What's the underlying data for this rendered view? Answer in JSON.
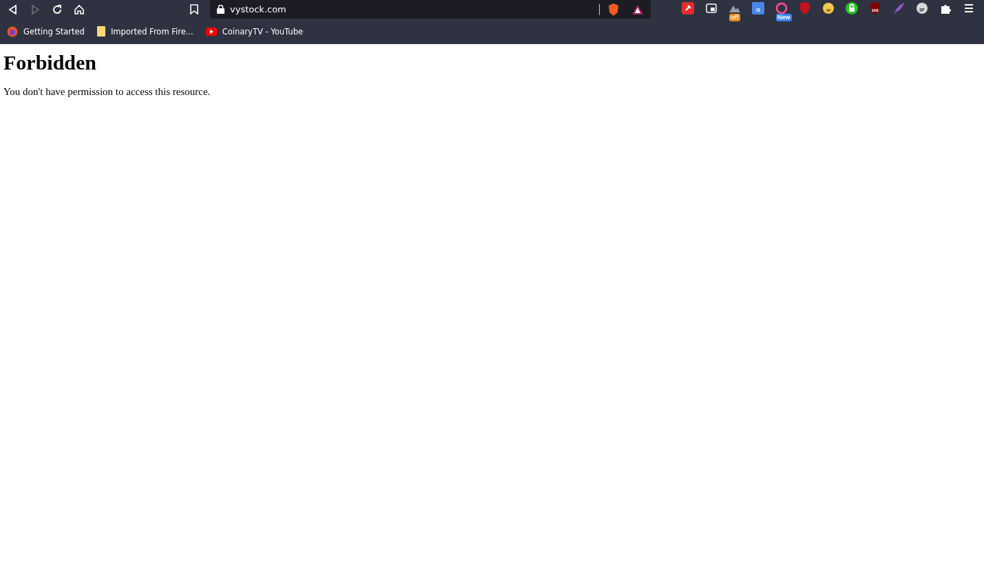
{
  "toolbar": {
    "url": "vystock.com",
    "back_disabled": false,
    "forward_disabled": true
  },
  "extensions": [
    {
      "kind": "pin",
      "color": "#e32b2b"
    },
    {
      "kind": "pip",
      "color": "#ffffff"
    },
    {
      "kind": "mountain",
      "color": "#9a9aa8",
      "badge": "off"
    },
    {
      "kind": "translate",
      "color": "#4a86e8",
      "glyph": "G"
    },
    {
      "kind": "ring",
      "color": "#e84a8a",
      "badge": "New"
    },
    {
      "kind": "shield",
      "color": "#c0141c"
    },
    {
      "kind": "circle",
      "color": "#f2c94c",
      "glyph": "w"
    },
    {
      "kind": "lock",
      "color": "#22c51e"
    },
    {
      "kind": "shield",
      "color": "#800000",
      "glyph": "uo"
    },
    {
      "kind": "feather",
      "color": "#8a5cc8"
    },
    {
      "kind": "circle",
      "color": "#d9d9d9",
      "glyph": "IP"
    },
    {
      "kind": "puzzle",
      "color": "#ffffff"
    },
    {
      "kind": "menu",
      "color": "#ffffff"
    }
  ],
  "bookmarks": [
    {
      "label": "Getting Started",
      "kind": "firefox"
    },
    {
      "label": "Imported From Fire...",
      "kind": "folder"
    },
    {
      "label": "CoinaryTV - YouTube",
      "kind": "youtube"
    }
  ],
  "page": {
    "heading": "Forbidden",
    "message": "You don't have permission to access this resource."
  }
}
